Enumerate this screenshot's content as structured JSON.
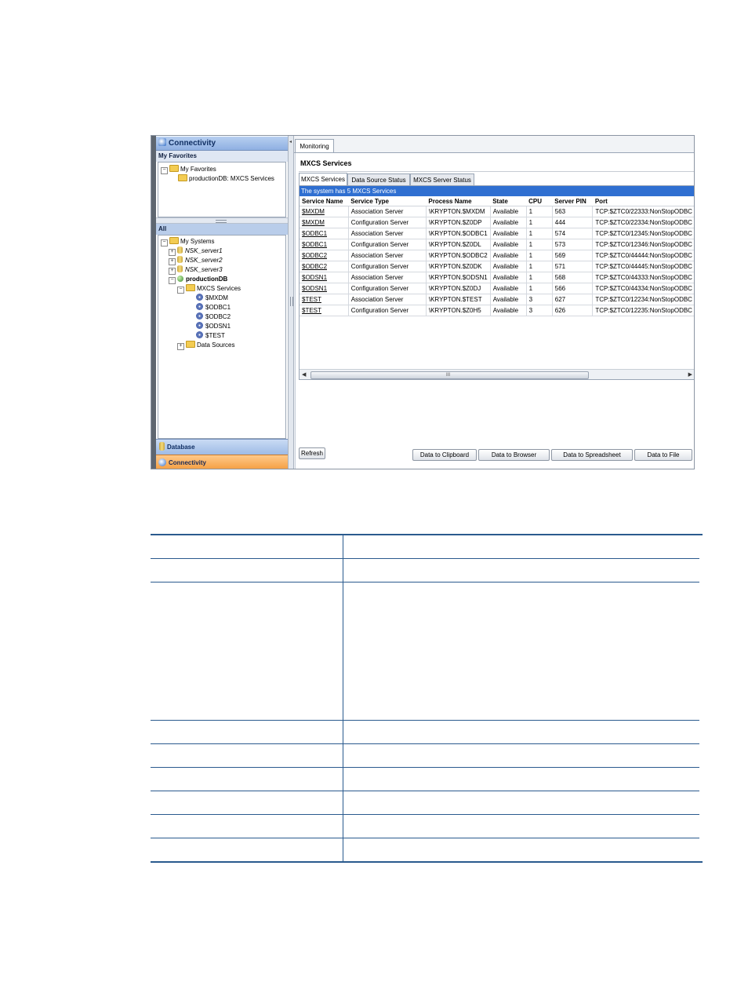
{
  "left_panel": {
    "connectivity_header": "Connectivity",
    "favorites": {
      "header": "My Favorites",
      "root": "My Favorites",
      "items": [
        "productionDB: MXCS Services"
      ]
    },
    "all": {
      "header": "All",
      "root": "My Systems",
      "servers": [
        "NSK_server1",
        "NSK_server2",
        "NSK_server3"
      ],
      "db": "productionDB",
      "services_folder": "MXCS Services",
      "services": [
        "$MXDM",
        "$ODBC1",
        "$ODBC2",
        "$ODSN1",
        "$TEST"
      ],
      "data_sources": "Data Sources"
    },
    "database_header": "Database",
    "connectivity_footer": "Connectivity"
  },
  "right_panel": {
    "monitoring_tab": "Monitoring",
    "title": "MXCS Services",
    "tabs": [
      "MXCS Services",
      "Data Source Status",
      "MXCS Server Status"
    ],
    "system_bar": "The system has 5 MXCS Services",
    "columns": [
      "Service Name",
      "Service Type",
      "Process Name",
      "State",
      "CPU",
      "Server PIN",
      "Port"
    ],
    "rows": [
      [
        "$MXDM",
        "Association Server",
        "\\KRYPTON.$MXDM",
        "Available",
        "1",
        "563",
        "TCP:$ZTC0/22333:NonStopODBC"
      ],
      [
        "$MXDM",
        "Configuration Server",
        "\\KRYPTON.$Z0DP",
        "Available",
        "1",
        "444",
        "TCP:$ZTC0/22334:NonStopODBC"
      ],
      [
        "$ODBC1",
        "Association Server",
        "\\KRYPTON.$ODBC1",
        "Available",
        "1",
        "574",
        "TCP:$ZTC0/12345:NonStopODBC"
      ],
      [
        "$ODBC1",
        "Configuration Server",
        "\\KRYPTON.$Z0DL",
        "Available",
        "1",
        "573",
        "TCP:$ZTC0/12346:NonStopODBC"
      ],
      [
        "$ODBC2",
        "Association Server",
        "\\KRYPTON.$ODBC2",
        "Available",
        "1",
        "569",
        "TCP:$ZTC0/44444:NonStopODBC"
      ],
      [
        "$ODBC2",
        "Configuration Server",
        "\\KRYPTON.$Z0DK",
        "Available",
        "1",
        "571",
        "TCP:$ZTC0/44445:NonStopODBC"
      ],
      [
        "$ODSN1",
        "Association Server",
        "\\KRYPTON.$ODSN1",
        "Available",
        "1",
        "568",
        "TCP:$ZTC0/44333:NonStopODBC"
      ],
      [
        "$ODSN1",
        "Configuration Server",
        "\\KRYPTON.$Z0DJ",
        "Available",
        "1",
        "566",
        "TCP:$ZTC0/44334:NonStopODBC"
      ],
      [
        "$TEST",
        "Association Server",
        "\\KRYPTON.$TEST",
        "Available",
        "3",
        "627",
        "TCP:$ZTC0/12234:NonStopODBC"
      ],
      [
        "$TEST",
        "Configuration Server",
        "\\KRYPTON.$Z0H5",
        "Available",
        "3",
        "626",
        "TCP:$ZTC0/12235:NonStopODBC"
      ]
    ],
    "scroll_grip": "III",
    "buttons": {
      "refresh": "Refresh",
      "clipboard": "Data to Clipboard",
      "browser": "Data to Browser",
      "spreadsheet": "Data to Spreadsheet",
      "file": "Data to File"
    }
  },
  "colors": {
    "system_bar": "#2f6fd1",
    "doc_rule": "#2a5a8e",
    "connectivity_active": "#f39a3a"
  }
}
